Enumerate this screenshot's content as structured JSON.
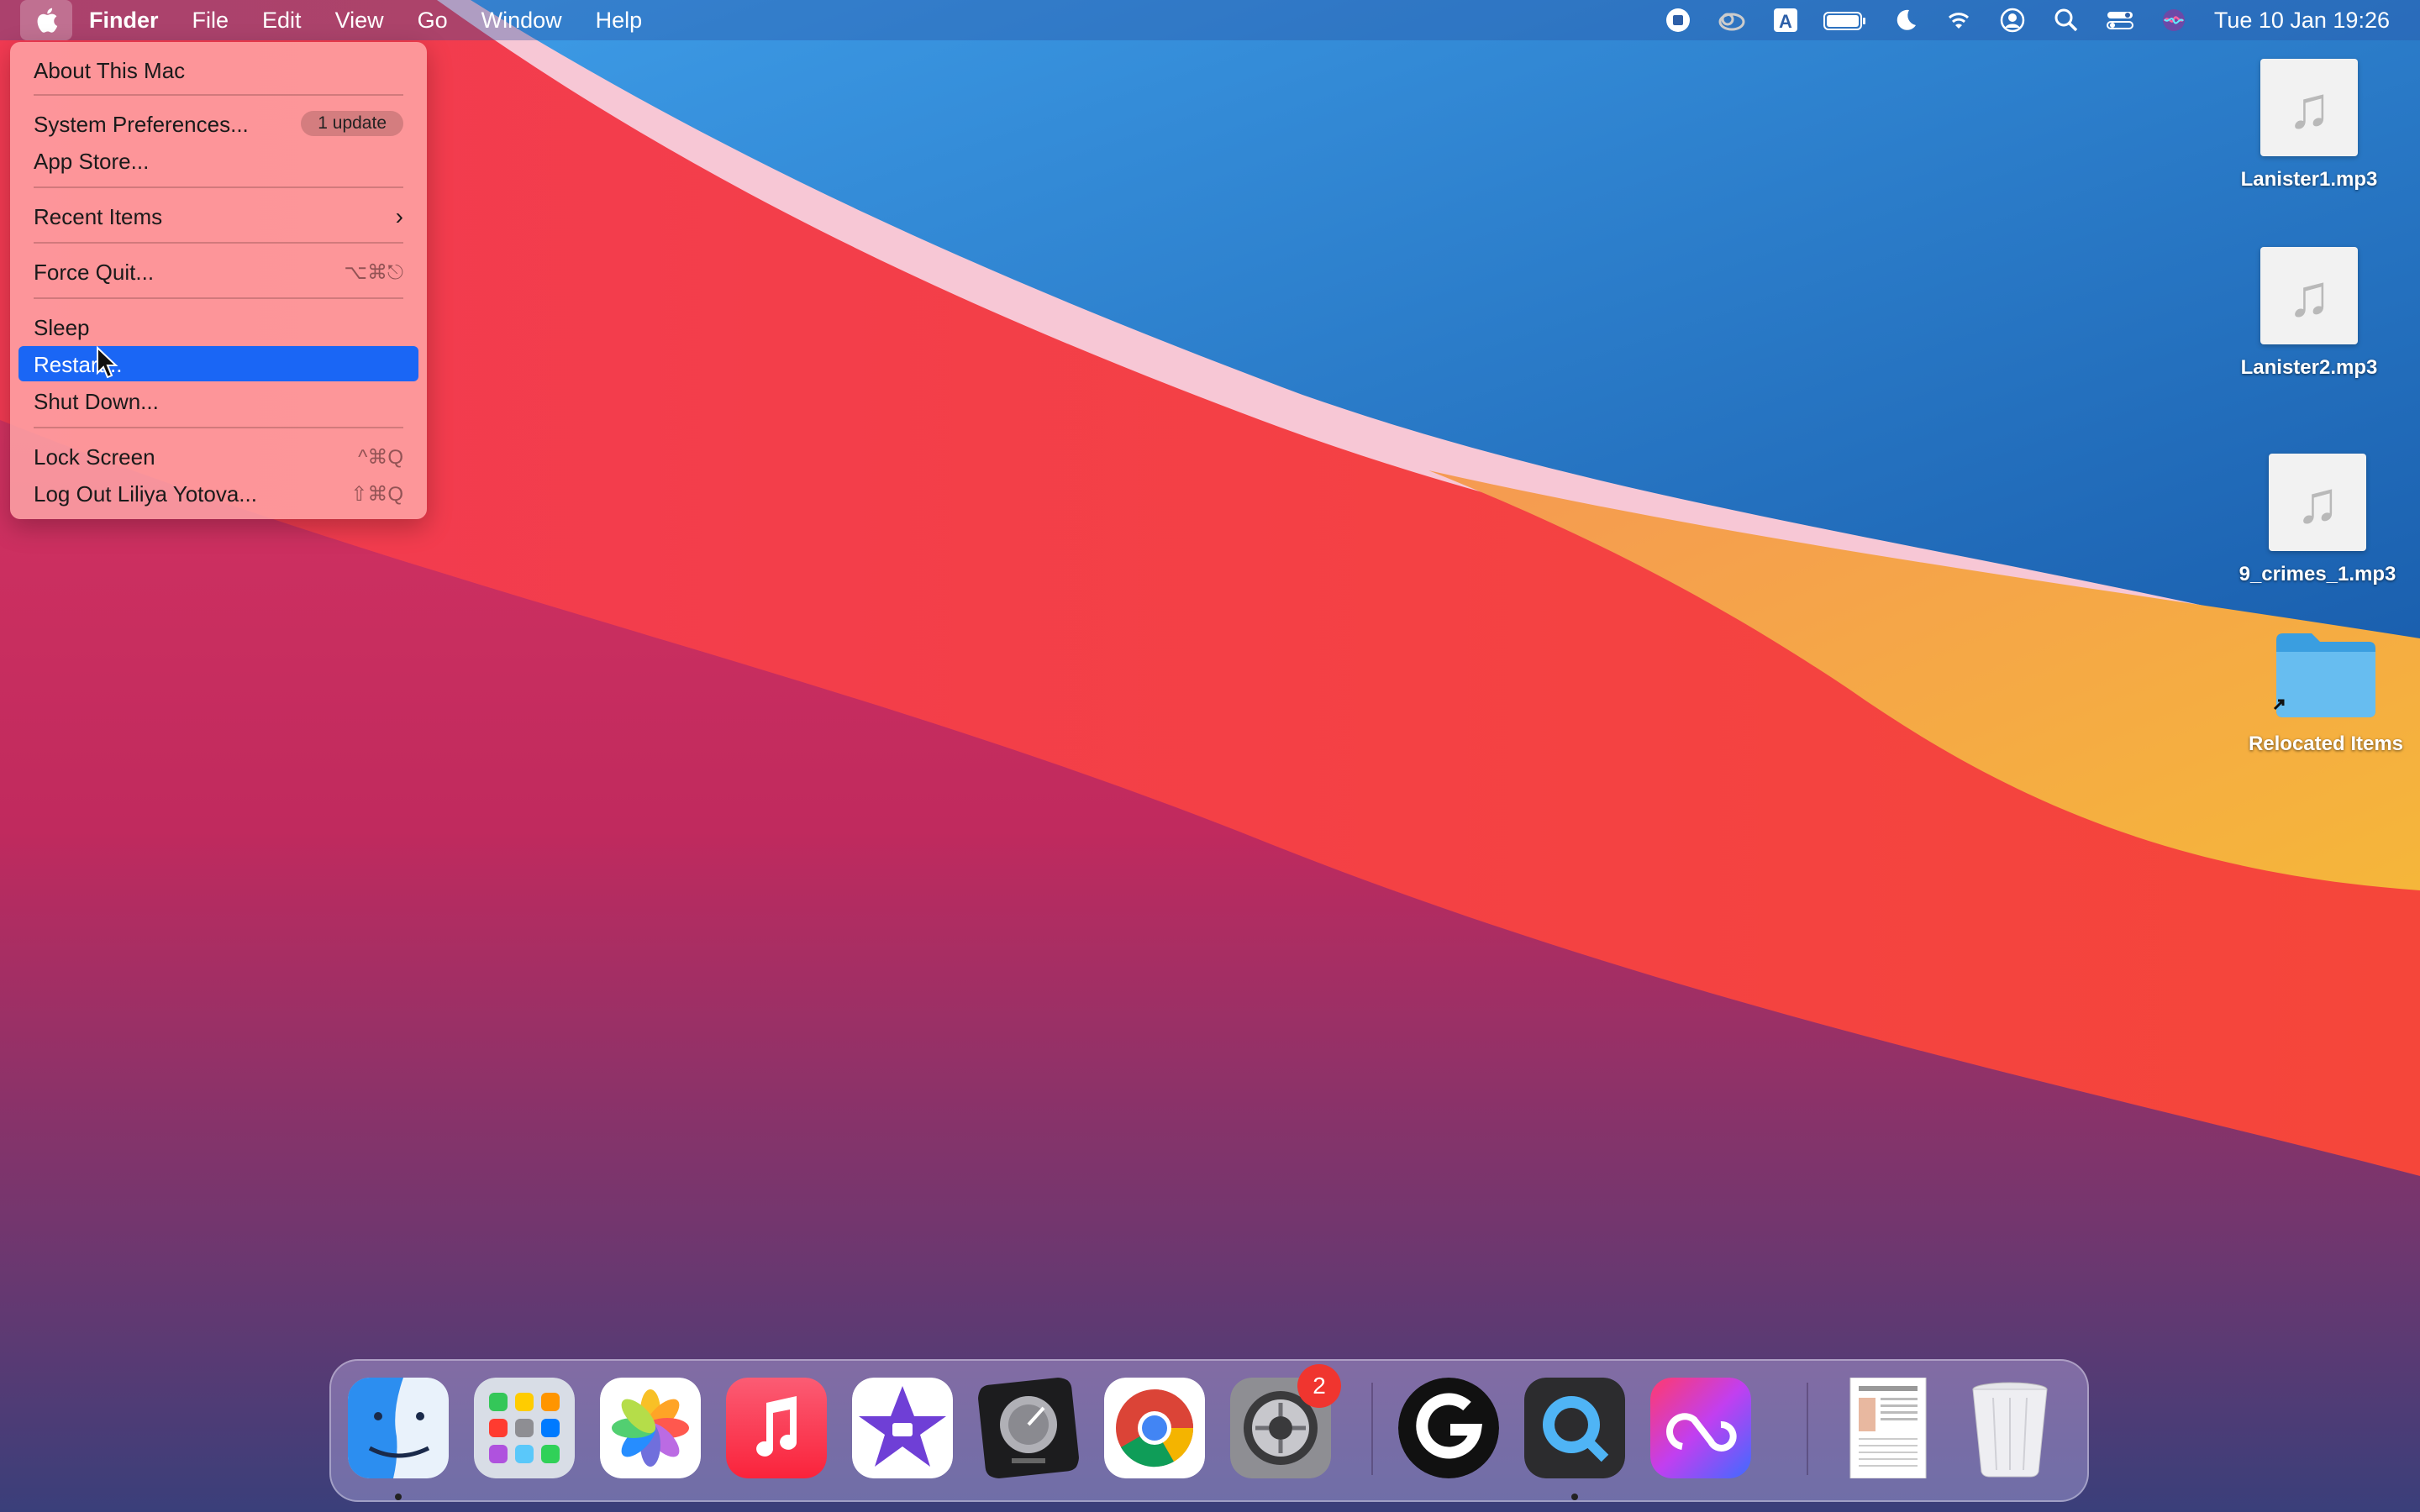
{
  "menubar": {
    "app_name": "Finder",
    "menus": [
      "File",
      "Edit",
      "View",
      "Go",
      "Window",
      "Help"
    ],
    "status_icons": [
      "screen-record-icon",
      "creative-cloud-icon",
      "input-source-icon",
      "battery-icon",
      "focus-moon-icon",
      "wifi-icon",
      "user-icon",
      "spotlight-search-icon",
      "control-center-icon",
      "siri-icon"
    ],
    "input_source": "A",
    "clock": "Tue 10 Jan  19:26"
  },
  "apple_menu": {
    "about": "About This Mac",
    "system_prefs": "System Preferences...",
    "system_prefs_badge": "1 update",
    "app_store": "App Store...",
    "recent_items": "Recent Items",
    "recent_items_arrow": "›",
    "force_quit": "Force Quit...",
    "force_quit_shortcut": "⌥⌘⎋",
    "sleep": "Sleep",
    "restart": "Restart...",
    "shutdown": "Shut Down...",
    "lock_screen": "Lock Screen",
    "lock_screen_shortcut": "^⌘Q",
    "logout": "Log Out Liliya Yotova...",
    "logout_shortcut": "⇧⌘Q"
  },
  "desktop": {
    "items": [
      {
        "name": "Lanister1.mp3",
        "glyph": "♫"
      },
      {
        "name": "Lanister2.mp3",
        "glyph": "♫"
      },
      {
        "name": "9_crimes_1.mp3",
        "glyph": "♫"
      },
      {
        "name": "Relocated Items",
        "glyph": ""
      }
    ]
  },
  "dock": {
    "apps": [
      "Finder",
      "Launchpad",
      "Photos",
      "Music",
      "iMovie",
      "Logic Pro",
      "Google Chrome",
      "System Preferences",
      "Logitech G HUB",
      "QuickTime Player",
      "Creative Cloud",
      "Document",
      "Trash"
    ],
    "system_prefs_badge": "2"
  },
  "colors": {
    "highlight": "#1a66f5",
    "badge_red": "#f0352f"
  }
}
